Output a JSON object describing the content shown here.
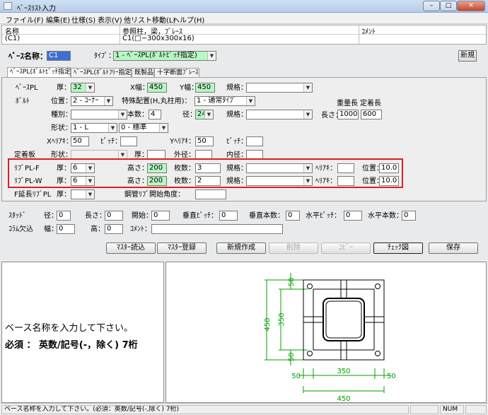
{
  "window": {
    "title": "ﾍﾞｰｽﾘｽﾄ入力",
    "minimize": "–",
    "maximize": "□",
    "close": "✕"
  },
  "menu": [
    "ファイル(F)",
    "編集(E)",
    "仕様(S)",
    "表示(V)",
    "他リスト移動(L)",
    "ヘルプ(H)"
  ],
  "header_grid": {
    "columns": [
      "名称",
      "参照柱，梁，ﾌﾞﾚｰｽ",
      "ｺﾒﾝﾄ"
    ],
    "row": [
      "(C1)",
      "C1(□−300x300x16)",
      ""
    ]
  },
  "base": {
    "name_label": "ﾍﾞｰｽ名称：",
    "name_value": "C1",
    "type_label": "ﾀｲﾌﾟ：",
    "type_value": "1 - ﾍﾞｰｽPL(ﾎﾞﾙﾄﾋﾟｯﾁ指定)",
    "new_badge": "新規"
  },
  "tabs": [
    "ﾍﾞｰｽPL(ﾎﾞﾙﾄﾋﾟｯﾁ指定)",
    "ﾍﾞｰｽPL(ﾎﾞﾙﾄﾌﾘｰ指定)",
    "既製品",
    "十字断面ﾌﾞﾚｰｽ"
  ],
  "baseplate": {
    "section": "ﾍﾞｰｽPL",
    "thick_label": "厚：",
    "thick": "32",
    "xwidth_label": "X幅：",
    "xwidth": "450",
    "ywidth_label": "Y幅：",
    "ywidth": "450",
    "spec_label": "規格：",
    "spec": ""
  },
  "bolt": {
    "section": "ﾎﾞﾙﾄ",
    "position_label": "位置：",
    "position": "2 - ｺｰﾅｰ",
    "special_label": "特殊配置(H,丸柱用)：",
    "special": "1 - 通常ﾀｲﾌﾟ",
    "weight_label": "重量長",
    "anchor_label": "定着長",
    "kind_label": "種別：",
    "kind": "",
    "count_label": "本数：",
    "count": "4",
    "dia_label": "径：",
    "dia": "24",
    "spec_label": "規格：",
    "spec": "",
    "length_label": "長さ：",
    "weight_len": "1000",
    "anchor_len": "600",
    "shape_label": "形状：",
    "shape": "1 - L",
    "std": "0 - 標準",
    "xedge_label": "Xﾍﾘｱｷ：",
    "xedge": "50",
    "xpitch_label": "ﾋﾟｯﾁ：",
    "xpitch": "",
    "yedge_label": "Yﾍﾘｱｷ：",
    "yedge": "50",
    "ypitch_label": "ﾋﾟｯﾁ：",
    "ypitch": ""
  },
  "anchor_plate": {
    "section": "定着板",
    "shape_label": "形状：",
    "shape": "",
    "thick_label": "厚：",
    "thick": "",
    "outer_label": "外径：",
    "outer": "",
    "inner_label": "内径：",
    "inner": ""
  },
  "rib_f": {
    "label": "ﾘﾌﾞPL-F",
    "thick_label": "厚：",
    "thick": "6",
    "height_label": "高さ：",
    "height": "200",
    "count_label": "枚数：",
    "count": "3",
    "spec_label": "規格：",
    "spec": "",
    "edge_label": "ﾍﾘｱｷ：",
    "edge": "",
    "pos_label": "位置：",
    "pos": "10.0"
  },
  "rib_w": {
    "label": "ﾘﾌﾞPL-W",
    "thick_label": "厚：",
    "thick": "6",
    "height_label": "高さ：",
    "height": "200",
    "count_label": "枚数：",
    "count": "2",
    "spec_label": "規格：",
    "spec": "",
    "edge_label": "ﾍﾘｱｷ：",
    "edge": "",
    "pos_label": "位置：",
    "pos": "10.0"
  },
  "f_rib": {
    "label": "F延長ﾘﾌﾞPL",
    "thick_label": "厚：",
    "thick": "",
    "angle_label": "鋼管ﾘﾌﾞ開始角度：",
    "angle": ""
  },
  "stud": {
    "label": "ｽﾀｯﾄﾞ",
    "dia_label": "径：",
    "dia": "0",
    "len_label": "長さ：",
    "len": "0",
    "start_label": "開始：",
    "start": "0",
    "vpitch_label": "垂直ﾋﾟｯﾁ：",
    "vpitch": "0",
    "vcount_label": "垂直本数：",
    "vcount": "0",
    "hpitch_label": "水平ﾋﾟｯﾁ：",
    "hpitch": "0",
    "hcount_label": "水平本数：",
    "hcount": "0"
  },
  "column_lack": {
    "label": "ｺﾗﾑ欠込",
    "width_label": "幅：",
    "width": "0",
    "height_label": "高：",
    "height": "0",
    "comment_label": "ｺﾒﾝﾄ：",
    "comment": ""
  },
  "buttons": {
    "master_load": "ﾏｽﾀｰ読込",
    "master_save": "ﾏｽﾀｰ登録",
    "new": "新規作成",
    "delete": "削除",
    "copy": "ｺﾋﾟｰ",
    "check": "ﾁｪｯｸ図",
    "save": "保存"
  },
  "message": {
    "line1": "ベース名称を入力して下さい。",
    "line2": "必須 ： 英数/記号(-，除く) 7桁"
  },
  "drawing": {
    "dim_total": "450",
    "dim_inner": "350",
    "dim_edge": "50",
    "color": "#00a000"
  },
  "status": {
    "text": "ベース名称を入力して下さい。(必須：英数/記号(-,除く) 7桁)",
    "num": "NUM"
  }
}
